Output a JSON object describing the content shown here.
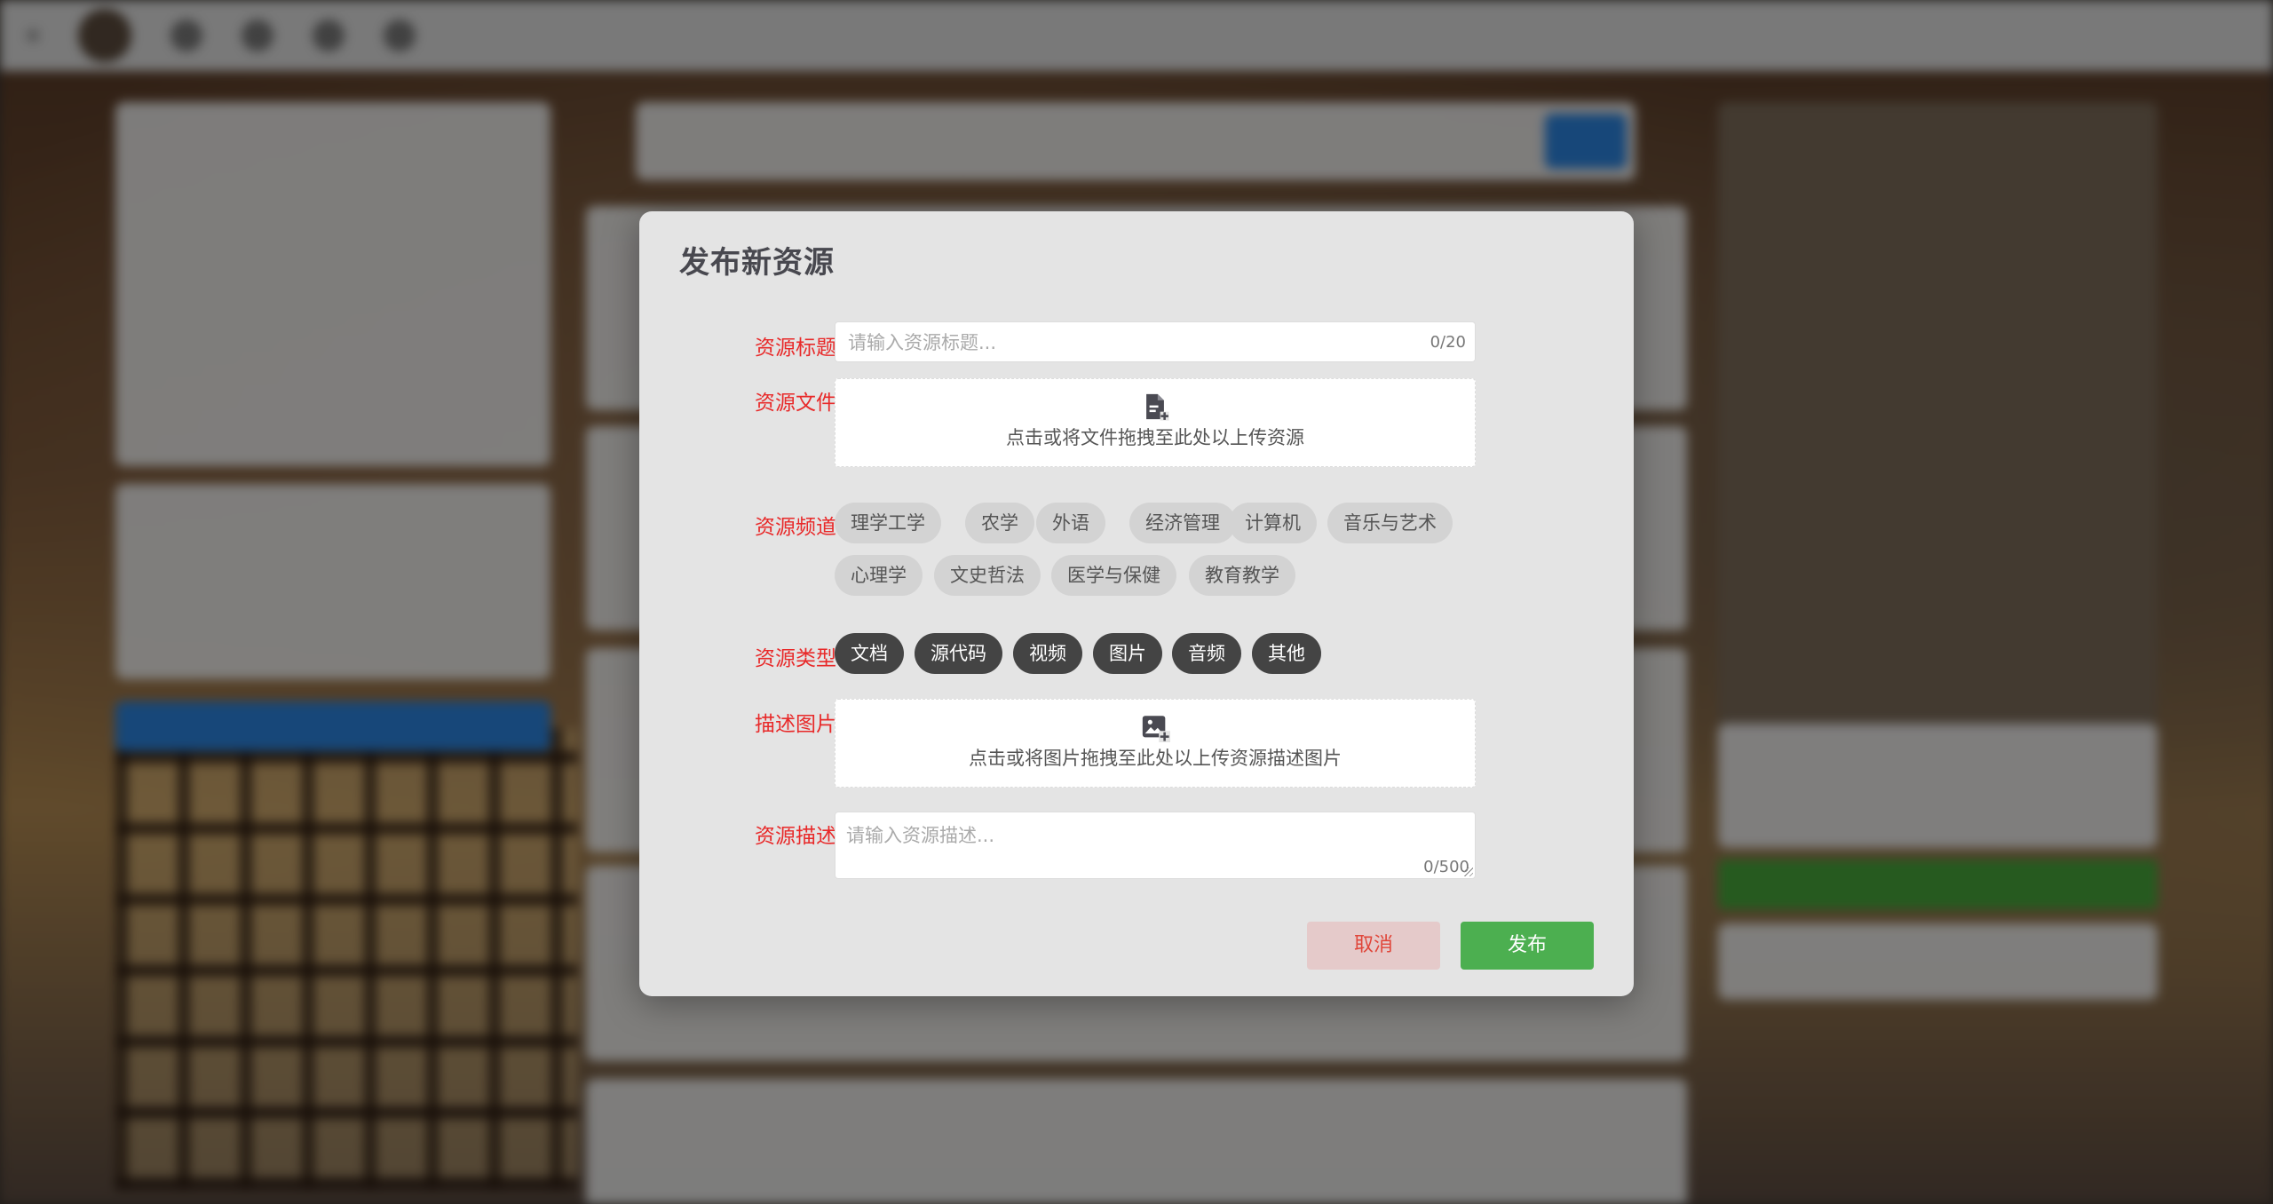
{
  "dialog": {
    "title": "发布新资源",
    "fields": {
      "title_label": "资源标题",
      "file_label": "资源文件",
      "channel_label": "资源频道",
      "type_label": "资源类型",
      "image_label": "描述图片",
      "desc_label": "资源描述"
    },
    "title_input": {
      "placeholder": "请输入资源标题...",
      "value": "",
      "counter": "0/20"
    },
    "file_upload": {
      "text": "点击或将文件拖拽至此处以上传资源",
      "icon": "file-add-icon"
    },
    "channels": [
      "理学工学",
      "农学",
      "外语",
      "经济管理",
      "计算机",
      "音乐与艺术",
      "心理学",
      "文史哲法",
      "医学与保健",
      "教育教学"
    ],
    "types": [
      "文档",
      "源代码",
      "视频",
      "图片",
      "音频",
      "其他"
    ],
    "image_upload": {
      "text": "点击或将图片拖拽至此处以上传资源描述图片",
      "icon": "image-add-icon"
    },
    "desc_input": {
      "placeholder": "请输入资源描述...",
      "value": "",
      "counter": "0/500"
    },
    "buttons": {
      "cancel": "取消",
      "submit": "发布"
    }
  },
  "colors": {
    "label_red": "#e82929",
    "type_chip_bg": "#444444",
    "channel_chip_bg": "#d3d3d3",
    "submit_green": "#4caf50",
    "cancel_bg": "#e5caca"
  }
}
